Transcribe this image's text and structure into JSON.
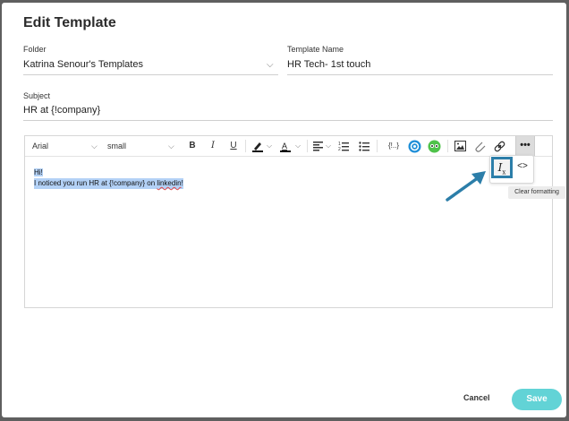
{
  "dialog": {
    "title": "Edit Template"
  },
  "folder": {
    "label": "Folder",
    "value": "Katrina Senour's Templates"
  },
  "template_name": {
    "label": "Template Name",
    "value": "HR Tech- 1st touch"
  },
  "subject": {
    "label": "Subject",
    "value": "HR at {!company}"
  },
  "toolbar": {
    "font_family": "Arial",
    "font_size": "small",
    "bold": "B",
    "italic": "I",
    "underline": "U",
    "placeholder_token": "{!..}",
    "more": "•••"
  },
  "body": {
    "line1": "Hi!",
    "line2_prefix": "I noticed you run HR at {!company} on ",
    "line2_misspelled": "linkedin",
    "line2_suffix": "!"
  },
  "popup": {
    "clear_label": "I",
    "clear_sub": "x",
    "code_label": "<>"
  },
  "tooltip": {
    "text": "Clear formatting"
  },
  "footer": {
    "cancel_label": "Cancel",
    "save_label": "Save"
  },
  "colors": {
    "accent": "#62d3d6",
    "highlight": "#2c7ea9",
    "selection": "#b3d1f6"
  }
}
